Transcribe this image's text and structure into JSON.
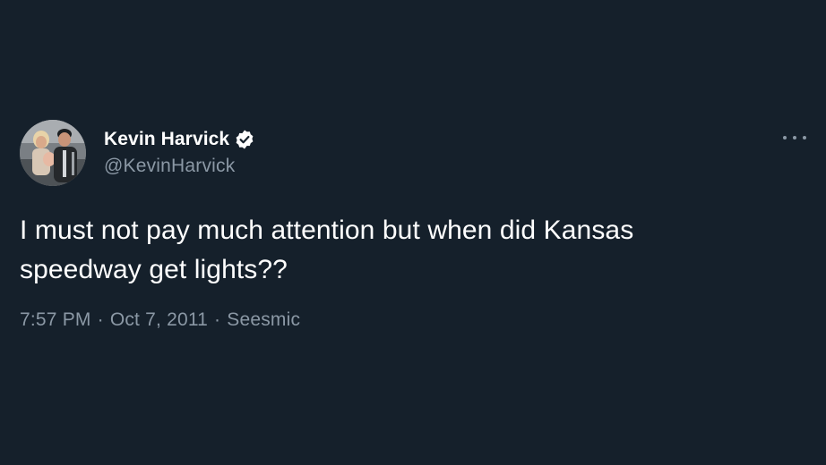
{
  "author": {
    "display_name": "Kevin Harvick",
    "handle": "@KevinHarvick",
    "verified_icon": "verified-badge-icon"
  },
  "tweet": {
    "text": "I must not pay much attention but when did Kansas speedway get lights??",
    "time": "7:57 PM",
    "separator": "·",
    "date": "Oct 7, 2011",
    "source": "Seesmic"
  },
  "menu": {
    "icon": "more-options-icon"
  },
  "colors": {
    "background": "#15202b",
    "primary_text": "#ffffff",
    "secondary_text": "#8b98a5"
  }
}
